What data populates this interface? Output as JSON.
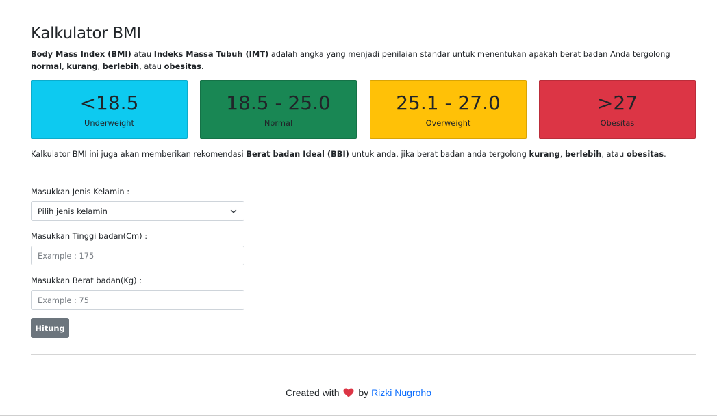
{
  "page": {
    "title": "Kalkulator BMI",
    "intro": {
      "t1": "Body Mass Index (BMI)",
      "t2": " atau ",
      "t3": "Indeks Massa Tubuh (IMT)",
      "t4": " adalah angka yang menjadi penilaian standar untuk menentukan apakah berat badan Anda tergolong ",
      "t5": "normal",
      "t6": ", ",
      "t7": "kurang",
      "t8": ", ",
      "t9": "berlebih",
      "t10": ", atau ",
      "t11": "obesitas",
      "t12": "."
    }
  },
  "cards": [
    {
      "range": "<18.5",
      "category": "Underweight",
      "color": "#0dcaf0"
    },
    {
      "range": "18.5 - 25.0",
      "category": "Normal",
      "color": "#198754"
    },
    {
      "range": "25.1 - 27.0",
      "category": "Overweight",
      "color": "#ffc107"
    },
    {
      "range": ">27",
      "category": "Obesitas",
      "color": "#dc3545"
    }
  ],
  "recommendation": {
    "t1": "Kalkulator BMI ini juga akan memberikan rekomendasi ",
    "t2": "Berat badan Ideal (BBI)",
    "t3": " untuk anda, jika berat badan anda tergolong ",
    "t4": "kurang",
    "t5": ", ",
    "t6": "berlebih",
    "t7": ", atau ",
    "t8": "obesitas",
    "t9": "."
  },
  "form": {
    "gender_label": "Masukkan Jenis Kelamin :",
    "gender_value": "Pilih jenis kelamin",
    "height_label": "Masukkan Tinggi badan(Cm) :",
    "height_placeholder": "Example : 175",
    "weight_label": "Masukkan Berat badan(Kg) :",
    "weight_placeholder": "Example : 75",
    "submit_label": "Hitung"
  },
  "footer": {
    "prefix": "Created with",
    "by": "by",
    "author": "Rizki Nugroho"
  }
}
